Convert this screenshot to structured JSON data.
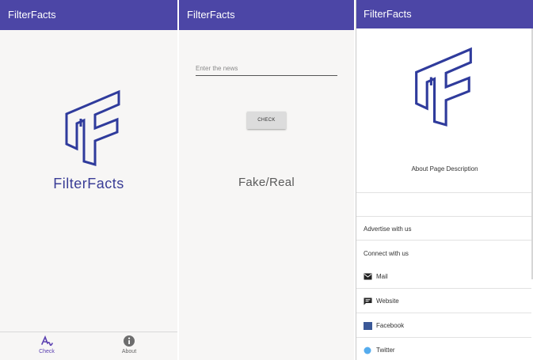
{
  "app": {
    "title": "FilterFacts"
  },
  "home": {
    "brand_name": "FilterFacts",
    "bottom_nav": [
      {
        "label": "Check",
        "icon": "check-wave-icon",
        "active": true
      },
      {
        "label": "About",
        "icon": "info-icon",
        "active": false
      }
    ]
  },
  "check": {
    "input_placeholder": "Enter the news",
    "button_label": "CHECK",
    "result_text": "Fake/Real"
  },
  "about": {
    "description": "About Page Description",
    "items": [
      {
        "label": "Advertise with us"
      },
      {
        "label": "Connect with us"
      },
      {
        "label": "Mail",
        "icon": "mail-icon"
      },
      {
        "label": "Website",
        "icon": "chat-icon"
      },
      {
        "label": "Facebook",
        "icon": "facebook-icon"
      },
      {
        "label": "Twitter",
        "icon": "twitter-icon"
      }
    ]
  },
  "colors": {
    "appbar": "#4c46a6",
    "brand": "#3a3d96",
    "active_nav": "#5a3fb0"
  }
}
